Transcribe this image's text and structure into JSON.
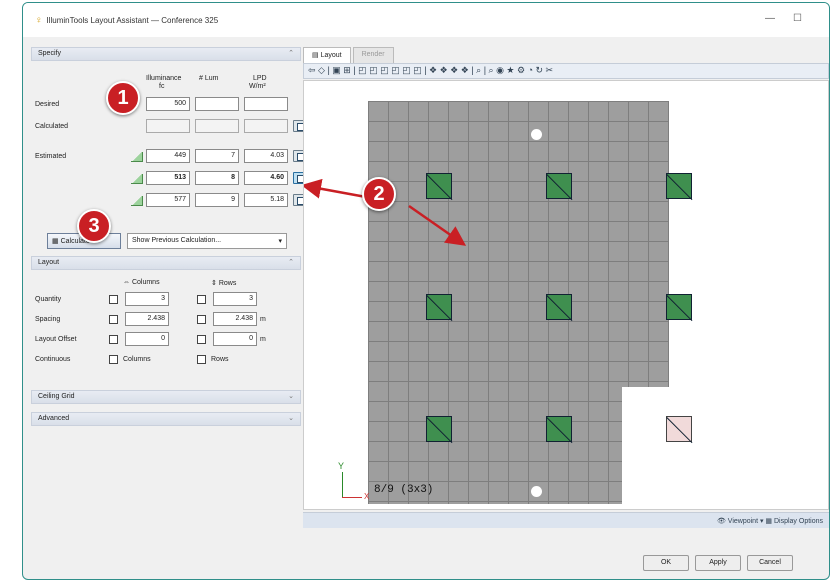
{
  "window": {
    "title": "IlluminTools Layout Assistant — Conference 325",
    "minimize": "—",
    "maximize": "☐"
  },
  "specify": {
    "header": "Specify",
    "col_lum": "Illuminance",
    "col_lum_unit": "fc",
    "col_nlum": "# Lum",
    "col_lpd": "LPD",
    "col_lpd_unit": "W/m²",
    "desired_label": "Desired",
    "desired_value": "500",
    "calculated_label": "Calculated",
    "estimated_label": "Estimated",
    "rows": [
      {
        "illum": "449",
        "lum": "7",
        "lpd": "4.03"
      },
      {
        "illum": "513",
        "lum": "8",
        "lpd": "4.60"
      },
      {
        "illum": "577",
        "lum": "9",
        "lpd": "5.18"
      }
    ],
    "calculate_button": "Calculate",
    "previous_select": "Show Previous Calculation..."
  },
  "layout": {
    "header": "Layout",
    "columns_label": "Columns",
    "rows_label": "Rows",
    "quantity_label": "Quantity",
    "quantity_cols": "3",
    "quantity_rows": "3",
    "spacing_label": "Spacing",
    "spacing_cols": "2.438",
    "spacing_rows": "2.438",
    "spacing_unit": "m",
    "offset_label": "Layout Offset",
    "offset_cols": "0",
    "offset_rows": "0",
    "offset_unit": "m",
    "continuous_label": "Continuous",
    "cont_columns": "Columns",
    "cont_rows": "Rows"
  },
  "ceiling_grid": {
    "header": "Ceiling Grid"
  },
  "advanced": {
    "header": "Advanced"
  },
  "tabs": [
    "Layout",
    "Render"
  ],
  "toolbar": {
    "icons": "⇦ ◇ | ▣ ⊞ | ◰ ◰ ◰ ◰ ◰ ◰ | ❖ ❖ ❖ ❖ | ⌕ | ⌕ ◉ ★ ⚙ ◔ ↻ ✂"
  },
  "canvas": {
    "status": "8/9  (3x3)",
    "axis_y": "Y",
    "axis_x": "X"
  },
  "statusbar": {
    "viewpoint": "👁 Viewpoint ▾  ▦ Display Options"
  },
  "buttons": {
    "ok": "OK",
    "apply": "Apply",
    "cancel": "Cancel"
  },
  "callouts": [
    "1",
    "2",
    "3"
  ],
  "colors": {
    "accent": "#c91f24",
    "fixture": "#3f8f4f",
    "grid": "#9e9e9e"
  }
}
